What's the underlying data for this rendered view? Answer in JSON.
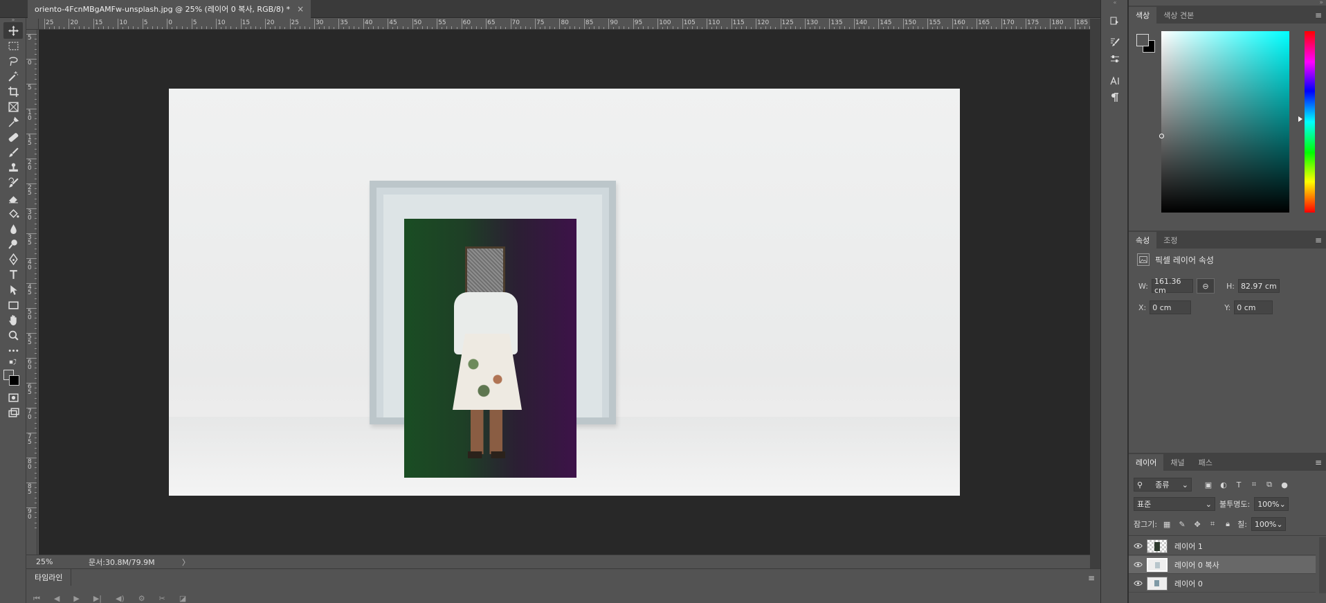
{
  "document": {
    "tab_title": "oriento-4FcnMBgAMFw-unsplash.jpg @ 25% (레이어 0 복사, RGB/8) *",
    "close_glyph": "×"
  },
  "ruler": {
    "h_labels": [
      "25",
      "20",
      "15",
      "10",
      "5",
      "0",
      "5",
      "10",
      "15",
      "20",
      "25",
      "30",
      "35",
      "40",
      "45",
      "50",
      "55",
      "60",
      "65",
      "70",
      "75",
      "80",
      "85",
      "90",
      "95",
      "100",
      "105",
      "110",
      "115",
      "120",
      "125",
      "130",
      "135",
      "140",
      "145",
      "150",
      "155",
      "160",
      "165",
      "170",
      "175",
      "180",
      "185"
    ],
    "v_labels": [
      "5",
      "0",
      "5",
      "1 0",
      "1 5",
      "2 0",
      "2 5",
      "3 0",
      "3 5",
      "4 0",
      "4 5",
      "5 0",
      "5 5",
      "6 0",
      "6 5",
      "7 0",
      "7 5",
      "8 0",
      "8 5",
      "9 0"
    ]
  },
  "status": {
    "zoom": "25%",
    "doc_info": "문서:30.8M/79.9M",
    "arrow": "〉"
  },
  "timeline": {
    "tab_label": "타임라인",
    "menu_glyph": "≡",
    "controls": [
      "⏮",
      "◀",
      "▶",
      "▶|",
      "◀)",
      "⚙",
      "✂",
      "◪"
    ]
  },
  "toolbar": {
    "tools": [
      "move-tool",
      "rect-marquee-tool",
      "lasso-tool",
      "magic-wand-tool",
      "crop-tool",
      "frame-tool",
      "eyedropper-tool",
      "healing-brush-tool",
      "brush-tool",
      "clone-stamp-tool",
      "history-brush-tool",
      "eraser-tool",
      "paint-bucket-tool",
      "blur-tool",
      "dodge-tool",
      "pen-tool",
      "type-tool",
      "path-selection-tool",
      "rectangle-tool",
      "hand-tool",
      "zoom-tool",
      "more-tools"
    ]
  },
  "color_panel": {
    "tabs": [
      "색상",
      "색상 견본"
    ],
    "foreground": "#555555",
    "background": "#000000",
    "hue": "#00ffff"
  },
  "properties_panel": {
    "tabs": [
      "속성",
      "조정"
    ],
    "title": "픽셀 레이어 속성",
    "w_label": "W:",
    "w_value": "161.36 cm",
    "h_label": "H:",
    "h_value": "82.97 cm",
    "x_label": "X:",
    "x_value": "0 cm",
    "y_label": "Y:",
    "y_value": "0 cm"
  },
  "layers_panel": {
    "tabs": [
      "레이어",
      "채널",
      "패스"
    ],
    "filter_kind": "종류",
    "blend_mode": "표준",
    "opacity_label": "불투명도:",
    "opacity_value": "100%",
    "lock_label": "잠그기:",
    "fill_label": "칠:",
    "fill_value": "100%",
    "layers": [
      {
        "name": "레이어 1",
        "visible": true,
        "selected": false
      },
      {
        "name": "레이어 0 복사",
        "visible": true,
        "selected": true
      },
      {
        "name": "레이어 0",
        "visible": true,
        "selected": false
      }
    ]
  }
}
